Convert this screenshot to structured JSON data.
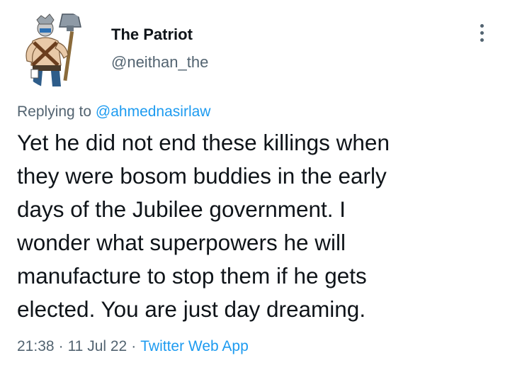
{
  "user": {
    "display_name": "The Patriot",
    "handle": "@neithan_the",
    "avatar_icon": "hammer-warrior-avatar"
  },
  "menu": {
    "icon": "more-dots-icon"
  },
  "reply": {
    "prefix": "Replying to ",
    "mention": "@ahmednasirlaw"
  },
  "tweet": {
    "lines": [
      "Yet he did not end these killings when",
      "they were bosom buddies in the early",
      "days of the Jubilee government. I",
      "wonder what superpowers he will",
      "manufacture to stop them if he gets",
      "elected. You are just day dreaming."
    ]
  },
  "meta": {
    "time": "21:38",
    "separator": "·",
    "date": "11 Jul 22",
    "source": "Twitter Web App"
  },
  "colors": {
    "text": "#0f1419",
    "secondary": "#536471",
    "link": "#1d9bf0"
  }
}
